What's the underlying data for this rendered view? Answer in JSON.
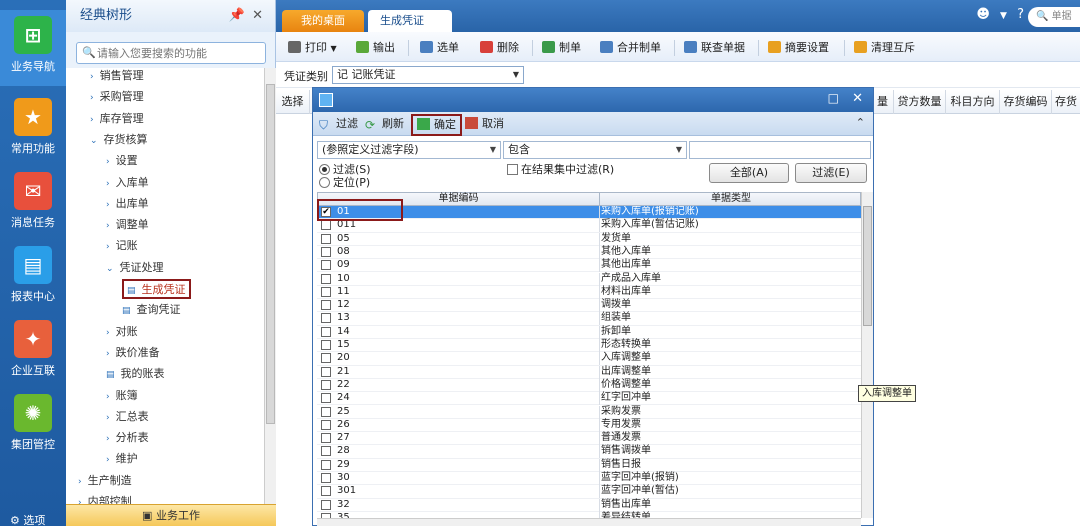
{
  "rail": {
    "items": [
      {
        "label": "业务导航",
        "icon": "business-nav-icon"
      },
      {
        "label": "常用功能",
        "icon": "star-icon"
      },
      {
        "label": "消息任务",
        "icon": "message-icon"
      },
      {
        "label": "报表中心",
        "icon": "report-icon"
      },
      {
        "label": "企业互联",
        "icon": "enterprise-link-icon"
      },
      {
        "label": "集团管控",
        "icon": "group-control-icon"
      },
      {
        "label": "选项",
        "icon": "gear-icon"
      }
    ]
  },
  "tree": {
    "title": "经典树形",
    "pin": "📌",
    "close": "✕",
    "search_placeholder": "请输入您要搜索的功能",
    "items": [
      {
        "label": "销售管理",
        "caret": "›"
      },
      {
        "label": "采购管理",
        "caret": "›"
      },
      {
        "label": "库存管理",
        "caret": "›"
      },
      {
        "label": "存货核算",
        "caret": "⌄"
      },
      {
        "label": "设置",
        "caret": "›"
      },
      {
        "label": "入库单",
        "caret": "›"
      },
      {
        "label": "出库单",
        "caret": "›"
      },
      {
        "label": "调整单",
        "caret": "›"
      },
      {
        "label": "记账",
        "caret": "›"
      },
      {
        "label": "凭证处理",
        "caret": "⌄"
      },
      {
        "label": "生成凭证",
        "caret": ""
      },
      {
        "label": "查询凭证",
        "caret": ""
      },
      {
        "label": "对账",
        "caret": "›"
      },
      {
        "label": "跌价准备",
        "caret": "›"
      },
      {
        "label": "我的账表",
        "caret": ""
      },
      {
        "label": "账簿",
        "caret": "›"
      },
      {
        "label": "汇总表",
        "caret": "›"
      },
      {
        "label": "分析表",
        "caret": "›"
      },
      {
        "label": "维护",
        "caret": "›"
      },
      {
        "label": "生产制造",
        "caret": "›"
      },
      {
        "label": "内部控制",
        "caret": "›"
      }
    ],
    "footer": "业务工作"
  },
  "tabs": {
    "home": "我的桌面",
    "active": "生成凭证",
    "close": "×",
    "search_placeholder": "单据"
  },
  "toolbar": [
    "打印",
    "输出",
    "选单",
    "删除",
    "制单",
    "合并制单",
    "联查单据",
    "摘要设置",
    "清理互斥"
  ],
  "voucher": {
    "label": "凭证类别",
    "value": "记 记账凭证"
  },
  "grid_headers": [
    "选择",
    "量",
    "贷方数量",
    "科目方向",
    "存货编码",
    "存货"
  ],
  "dialog": {
    "toolbar": [
      "过滤",
      "刷新",
      "确定",
      "取消"
    ],
    "filter_field": "(参照定义过滤字段)",
    "filter_op": "包含",
    "filter_value": "",
    "radio_filter": "过滤(S)",
    "radio_locate": "定位(P)",
    "check_in_result": "在结果集中过滤(R)",
    "btn_all": "全部(A)",
    "btn_filter": "过滤(E)",
    "col_code": "单据编码",
    "col_type": "单据类型",
    "rows": [
      {
        "code": "01",
        "type": "采购入库单(报销记账)",
        "checked": true
      },
      {
        "code": "011",
        "type": "采购入库单(暂估记账)",
        "checked": false
      },
      {
        "code": "05",
        "type": "发货单",
        "checked": false
      },
      {
        "code": "08",
        "type": "其他入库单",
        "checked": false
      },
      {
        "code": "09",
        "type": "其他出库单",
        "checked": false
      },
      {
        "code": "10",
        "type": "产成品入库单",
        "checked": false
      },
      {
        "code": "11",
        "type": "材料出库单",
        "checked": false
      },
      {
        "code": "12",
        "type": "调拨单",
        "checked": false
      },
      {
        "code": "13",
        "type": "组装单",
        "checked": false
      },
      {
        "code": "14",
        "type": "拆卸单",
        "checked": false
      },
      {
        "code": "15",
        "type": "形态转换单",
        "checked": false
      },
      {
        "code": "20",
        "type": "入库调整单",
        "checked": false
      },
      {
        "code": "21",
        "type": "出库调整单",
        "checked": false
      },
      {
        "code": "22",
        "type": "价格调整单",
        "checked": false
      },
      {
        "code": "24",
        "type": "红字回冲单",
        "checked": false
      },
      {
        "code": "25",
        "type": "采购发票",
        "checked": false
      },
      {
        "code": "26",
        "type": "专用发票",
        "checked": false
      },
      {
        "code": "27",
        "type": "普通发票",
        "checked": false
      },
      {
        "code": "28",
        "type": "销售调拨单",
        "checked": false
      },
      {
        "code": "29",
        "type": "销售日报",
        "checked": false
      },
      {
        "code": "30",
        "type": "蓝字回冲单(报销)",
        "checked": false
      },
      {
        "code": "301",
        "type": "蓝字回冲单(暂估)",
        "checked": false
      },
      {
        "code": "32",
        "type": "销售出库单",
        "checked": false
      },
      {
        "code": "35",
        "type": "差异结转单",
        "checked": false
      }
    ]
  },
  "tooltip": "入库调整单",
  "colors": {
    "accent": "#2a6fb8",
    "highlight": "#8b1a1a",
    "selected_row": "#3d8ee8"
  }
}
